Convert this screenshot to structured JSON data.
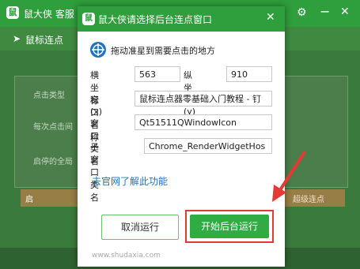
{
  "background_app": {
    "title": "鼠大侠 客服",
    "toolbar_tab": "鼠标连点",
    "labels": [
      "点击类型",
      "每次点击间",
      "启停的全局"
    ],
    "bottom_left": "启",
    "bottom_right": "超级连点"
  },
  "dialog": {
    "title": "鼠大侠请选择后台连点窗口",
    "drag_instruction": "拖动准星到需要点击的地方",
    "x_label": "横坐标(x)",
    "x_value": "563",
    "y_label": "纵坐标(y)",
    "y_value": "910",
    "window_name_label": "窗口名称",
    "window_name_value": "鼠标连点器零基础入门教程 - 钉",
    "window_class_label": "窗口类名",
    "window_class_value": "Qt51511QWindowIcon",
    "child_class_label": "子窗口类名",
    "child_class_value": "Chrome_RenderWidgetHos",
    "help_link": "去官网了解此功能",
    "cancel_button": "取消运行",
    "start_button": "开始后台运行",
    "footer_url": "www.shudaxia.com"
  },
  "colors": {
    "brand_green": "#2f9e3c",
    "start_button": "#2fad43",
    "link_blue": "#1e73be",
    "highlight_red": "#e53935"
  }
}
